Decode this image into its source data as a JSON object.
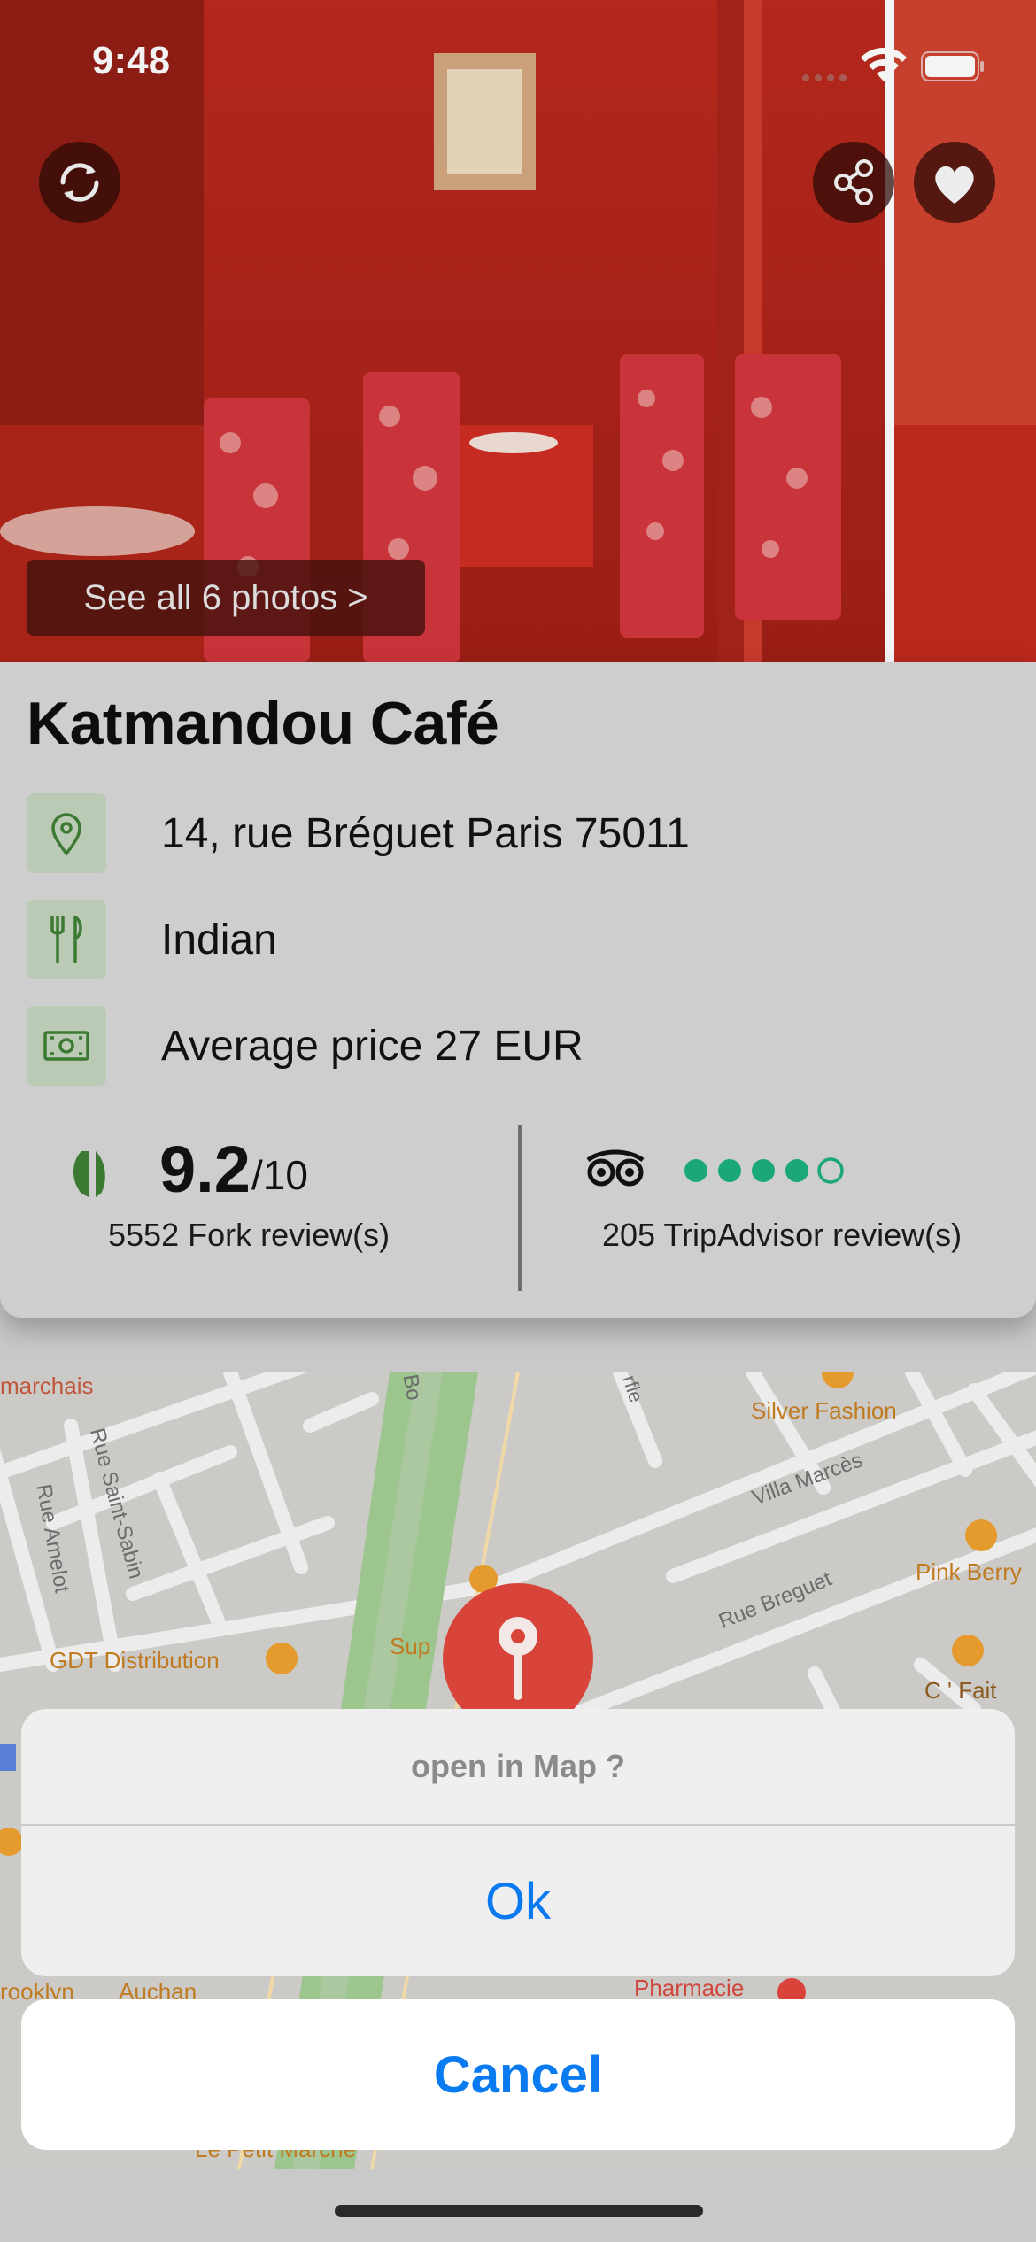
{
  "status": {
    "time": "9:48"
  },
  "photos": {
    "see_all": "See all 6 photos >"
  },
  "restaurant": {
    "name": "Katmandou Café",
    "address": "14, rue Bréguet Paris 75011",
    "cuisine": "Indian",
    "price": "Average price 27 EUR"
  },
  "ratings": {
    "fork_score": "9.2",
    "fork_scale": "/10",
    "fork_reviews": "5552 Fork review(s)",
    "tripadvisor_bubbles_filled": 4,
    "tripadvisor_bubbles_total": 5,
    "tripadvisor_reviews": "205 TripAdvisor review(s)"
  },
  "map": {
    "labels": {
      "marchais": "marchais",
      "silver_fashion": "Silver Fashion",
      "villa_marces": "Villa Marcès",
      "pink_berry": "Pink Berry",
      "rue_saint_sabin": "Rue Saint-Sabin",
      "rue_amelot": "Rue Amelot",
      "gdt": "GDT Distribution",
      "rue_breguet": "Rue Breguet",
      "cfait": "C ' Fait",
      "sup": "Sup",
      "bo": "Bo",
      "rfle": "rfle",
      "brooklyn": "rooklyn",
      "auchan": "Auchan",
      "pharmacie": "Pharmacie",
      "le_petit_marche": "Le Petit Marche"
    }
  },
  "action_sheet": {
    "title": "open in Map ?",
    "ok": "Ok",
    "cancel": "Cancel"
  },
  "colors": {
    "accent_blue": "#0a7af0",
    "fork_green": "#3c7a34",
    "tripadvisor_green": "#1aa878",
    "pin_red": "#d8443a"
  }
}
